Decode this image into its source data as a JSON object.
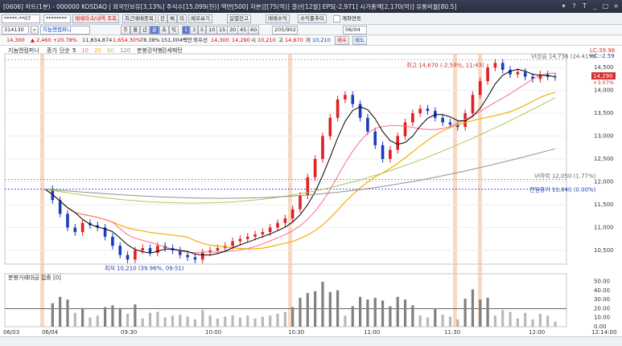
{
  "window": {
    "title": "[0606] 차트(1분) - 000000 KOSDAQ | 외국인보유[3,13%] 주식수[15,099(천)] 액면[500] 자본금[75(억)] 결산[12월] EPS[-2,971] 시가총액[2,170(억)] 유통비율[80.5]",
    "buttons": [
      "▾",
      "?",
      "T",
      "_",
      "□",
      "×"
    ]
  },
  "toolbar1": {
    "account": "*****-**07",
    "password": "********",
    "buttons": [
      "매매마크/내역 조회",
      "최근매매종목",
      "잔",
      "체",
      "미",
      "메모보기",
      "일별잔고",
      "매매수익",
      "수익률추이"
    ],
    "checkbox_label": "계좌연동"
  },
  "toolbar2": {
    "code": "314130",
    "name": "지놈앤컴퍼니",
    "period_buttons": [
      "주",
      "월",
      "년",
      "분",
      "초",
      "틱"
    ],
    "interval_buttons": [
      "1",
      "3",
      "5",
      "10",
      "15",
      "30",
      "45",
      "60"
    ],
    "count": "205/902",
    "date": "06/04"
  },
  "toolbar3": {
    "price": "14,300",
    "change": "▲ 2,460 +20.78%",
    "volume": "11,834,874",
    "amount": "1,654.30%",
    "trade_value": "78.38%",
    "value_mil": "151,004백만",
    "foreign": "외우선",
    "open_label": "시",
    "open": "14,300",
    "high_label": "고",
    "high": "14,670",
    "low_label": "저",
    "low": "10,210",
    "cur": "14,290",
    "buy_label": "매수",
    "sell_label": "매도"
  },
  "legend": {
    "name": "지놈앤컴퍼니",
    "items": [
      "종가",
      "단순",
      "5",
      "10",
      "20",
      "60",
      "120",
      "분봉강약봉",
      "강세패턴"
    ]
  },
  "price_axis": {
    "ticks": [
      "14,500",
      "14,000",
      "13,500",
      "13,000",
      "12,500",
      "12,000",
      "11,500",
      "11,000",
      "10,500"
    ],
    "markers": [
      "LC:39.96",
      "HC:-2.59",
      "14,290",
      "+3.07%"
    ]
  },
  "annotations": {
    "high": "최고 14,670 (-2.59%, 11:43)",
    "low": "최저 10,210 (39.96%, 09:51)",
    "vi_up": "VI상승 14,736 (24.41%)",
    "vi_base": "VI하락 12,050 (1.77%)",
    "prev_close": "전일종가 11,840 (0.00%)"
  },
  "volume_panel": {
    "title": "분봉거래대금 집중 [0]",
    "ticks": [
      "50.00",
      "40.00",
      "30.00",
      "20.00",
      "10.00",
      "0.00"
    ]
  },
  "time_axis": {
    "labels": [
      "06/03",
      "06/04",
      "09:30",
      "10:00",
      "10:30",
      "11:00",
      "11:30",
      "12:00",
      "12:14:00"
    ]
  },
  "chart_data": {
    "type": "candlestick",
    "prev_close": 11840,
    "high": 14670,
    "low": 10210,
    "ylim": [
      10200,
      14800
    ],
    "close_path": [
      11840,
      11600,
      11300,
      11000,
      10900,
      11100,
      11050,
      11000,
      10800,
      10600,
      10400,
      10300,
      10500,
      10550,
      10450,
      10600,
      10550,
      10500,
      10400,
      10350,
      10300,
      10450,
      10500,
      10550,
      10600,
      10700,
      10750,
      10800,
      10850,
      10900,
      11000,
      11100,
      11200,
      11400,
      11700,
      12100,
      12500,
      13000,
      13400,
      13800,
      13900,
      13700,
      13400,
      13100,
      12800,
      12500,
      12700,
      13000,
      13300,
      13500,
      13600,
      13550,
      13400,
      13300,
      13250,
      13200,
      13500,
      13900,
      14200,
      14500,
      14600,
      14450,
      14350,
      14400,
      14300,
      14250,
      14350,
      14300,
      14290
    ]
  },
  "colors": {
    "up": "#e02020",
    "down": "#1a3cc0",
    "ma5": "#000000",
    "ma10": "#ff6a8a",
    "ma20": "#f0b000",
    "ma60": "#b0c850",
    "ma120": "#909090",
    "highlight": "#f6c8a8"
  }
}
